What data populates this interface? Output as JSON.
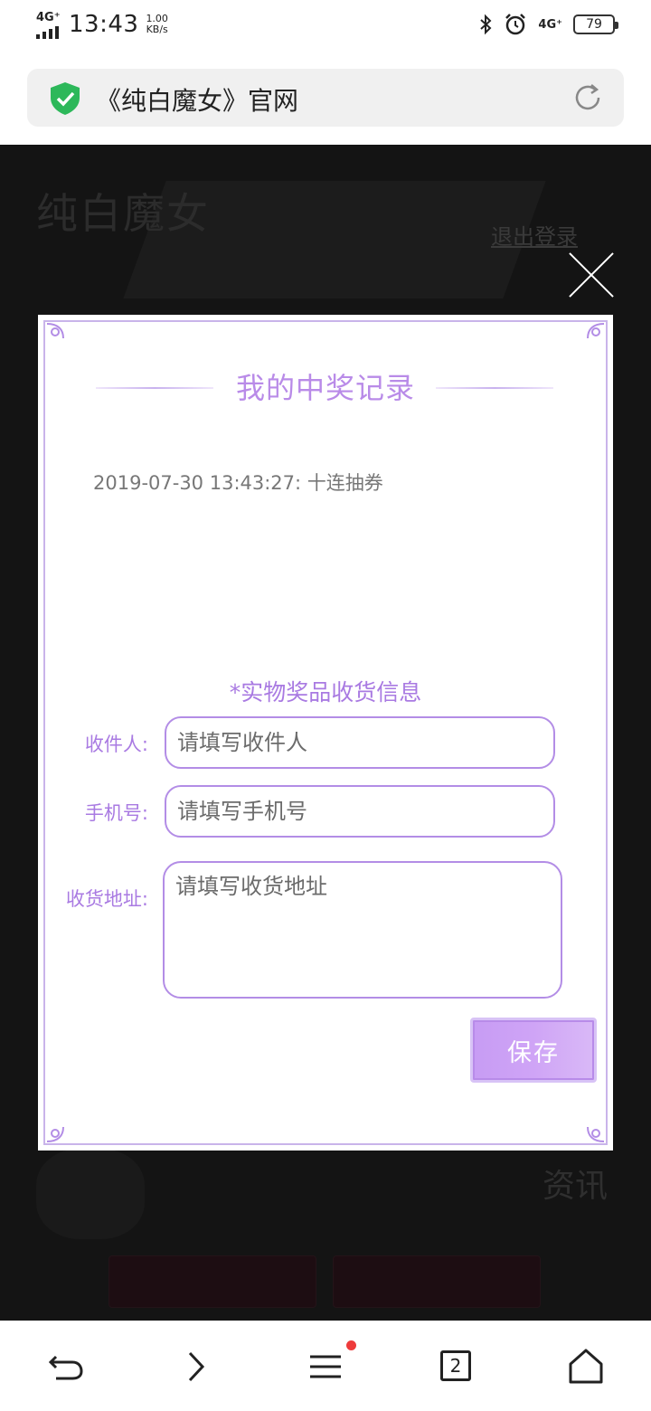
{
  "status_bar": {
    "network": "4G⁺",
    "time": "13:43",
    "speed_value": "1.00",
    "speed_unit": "KB/s",
    "network_right": "4G⁺",
    "battery": "79"
  },
  "browser": {
    "page_title": "《纯白魔女》官网",
    "tab_count": "2"
  },
  "page": {
    "logo": "纯白魔女",
    "logout": "退出登录",
    "news": "资讯"
  },
  "modal": {
    "title": "我的中奖记录",
    "records": [
      "2019-07-30 13:43:27: 十连抽券"
    ],
    "section_title": "*实物奖品收货信息",
    "recipient_label": "收件人:",
    "recipient_placeholder": "请填写收件人",
    "phone_label": "手机号:",
    "phone_placeholder": "请填写手机号",
    "address_label": "收货地址:",
    "address_placeholder": "请填写收货地址",
    "save": "保存"
  },
  "colors": {
    "accent": "#a97ae2",
    "border": "#b38de6",
    "page_bg": "#141414"
  }
}
